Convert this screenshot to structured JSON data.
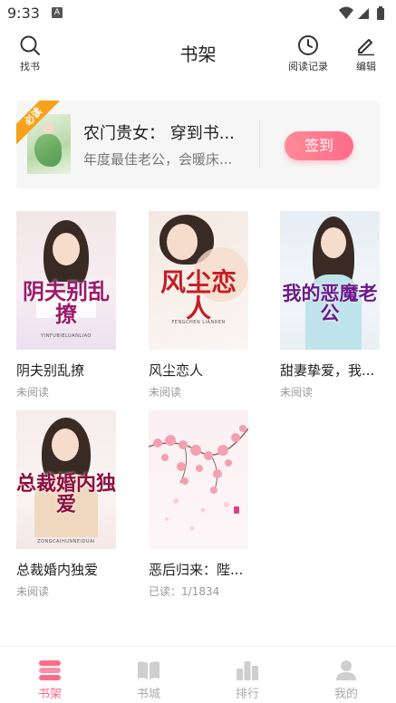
{
  "status_bar": {
    "time": "9:33",
    "notif_glyph": "A"
  },
  "header": {
    "title": "书架",
    "search_label": "找书",
    "history_label": "阅读记录",
    "edit_label": "编辑"
  },
  "banner": {
    "ribbon": "必读",
    "title": "农门贵女： 穿到书...",
    "desc": "年度最佳老公，会暖床...",
    "signin_label": "签到"
  },
  "books": [
    {
      "title": "阴夫别乱撩",
      "status": "未阅读",
      "cover_text": "阴夫别乱撩",
      "cover_sub": "YINFUBIELUANLIAO"
    },
    {
      "title": "风尘恋人",
      "status": "未阅读",
      "cover_text": "风尘恋人",
      "cover_sub": "FENGCHEN LIANREN"
    },
    {
      "title": "甜妻挚爱，我...",
      "status": "未阅读",
      "cover_text": "我的恶魔老公",
      "cover_sub": ""
    },
    {
      "title": "总裁婚内独爱",
      "status": "未阅读",
      "cover_text": "总裁婚内独爱",
      "cover_sub": "ZONGCAIHUNNEIDUAI"
    },
    {
      "title": "恶后归来：陛...",
      "status": "已读：1/1834",
      "cover_text": "",
      "cover_sub": ""
    }
  ],
  "tabbar": {
    "tabs": [
      {
        "label": "书架",
        "active": true
      },
      {
        "label": "书城",
        "active": false
      },
      {
        "label": "排行",
        "active": false
      },
      {
        "label": "我的",
        "active": false
      }
    ]
  },
  "colors": {
    "accent": "#ff6b8a",
    "inactive": "#aaaaaa"
  }
}
